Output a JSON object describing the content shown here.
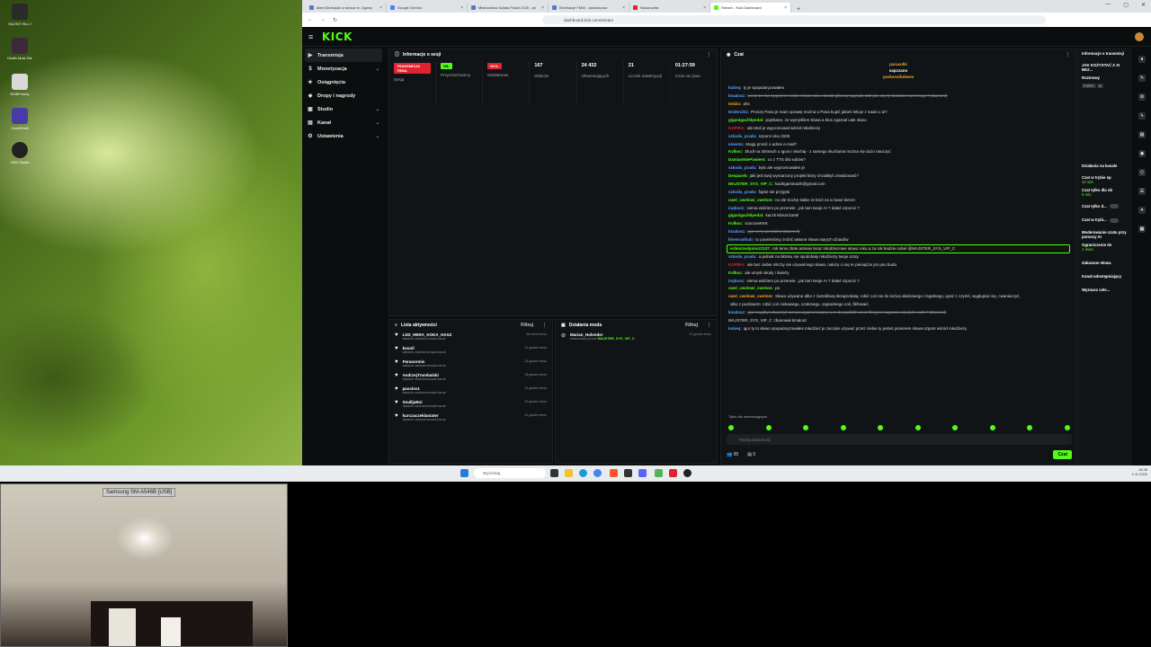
{
  "desktop": {
    "icons": [
      {
        "label": "SILENT HILL f",
        "color": "#2b2b2b"
      },
      {
        "label": "Death Must Die",
        "color": "#3a2a3a"
      },
      {
        "label": "ROBProkey",
        "color": "#d9d9d9"
      },
      {
        "label": "ChatWheel",
        "color": "#4a3aa8"
      },
      {
        "label": "OBS Studio",
        "color": "#222"
      }
    ]
  },
  "browser": {
    "tabs": [
      {
        "label": "Mam Bezludak w wiosce w ,Ogano"
      },
      {
        "label": "Google Gemini"
      },
      {
        "label": "Mistrzostwa Swiata Polski 2025 - pri"
      },
      {
        "label": "Eliminacje FMW - wiadomosci"
      },
      {
        "label": "Nowa karta"
      },
      {
        "label": "Stream - Kick Dashboard",
        "active": true
      }
    ],
    "url": "dashboard.kick.com/stream"
  },
  "kick": {
    "logo": "KICK",
    "nav": [
      {
        "label": "Transmisja",
        "icon": "▶",
        "active": true
      },
      {
        "label": "Monetyzacja",
        "icon": "$",
        "chev": "⌄"
      },
      {
        "label": "Osiągnięcia",
        "icon": "★"
      },
      {
        "label": "Dropy i nagrody",
        "icon": "◆"
      },
      {
        "label": "Studio",
        "icon": "▣",
        "chev": "⌄"
      },
      {
        "label": "Kanał",
        "icon": "▤",
        "chev": "⌄"
      },
      {
        "label": "Ustawienia",
        "icon": "⚙",
        "chev": "⌄"
      }
    ],
    "session": {
      "title": "Informacje o sesji",
      "stats": [
        {
          "badge": "TRANSMISJA TRWA",
          "color": "#e2222e",
          "label": "Sesja"
        },
        {
          "badge": "WŁ.",
          "color": "#53fc18",
          "label": "Przychód twórcy"
        },
        {
          "badge": "WYŁ.",
          "color": "#e2222e",
          "label": "Multistream"
        },
        {
          "value": "167",
          "label": "Widzów"
        },
        {
          "value": "24 432",
          "label": "Obserwujących"
        },
        {
          "value": "21",
          "label": "Licznik subskrypcji"
        },
        {
          "value": "01:27:59",
          "label": "Czas na żywo"
        }
      ]
    },
    "activity": {
      "title": "Lista aktywności",
      "filter": "Filtruj",
      "items": [
        {
          "name": "LSD_HERA_KOKA_HASZ",
          "sub": "właśnie zaobserwował kanał",
          "time": "26 minut temu"
        },
        {
          "name": "kosoil",
          "sub": "właśnie zaobserwował kanał",
          "time": "12 godzin temu"
        },
        {
          "name": "Paranormis",
          "sub": "właśnie zaobserwował kanał",
          "time": "18 godzin temu"
        },
        {
          "name": "AndrzejTrombalski",
          "sub": "właśnie zaobserwował kanał",
          "time": "18 godzin temu"
        },
        {
          "name": "pavclov1",
          "sub": "właśnie zaobserwował kanał",
          "time": "19 godzin temu"
        },
        {
          "name": "SoulljaBoi",
          "sub": "właśnie zaobserwował kanał",
          "time": "20 godzin temu"
        },
        {
          "name": "kurczaczeklaniater",
          "sub": "właśnie zaobserwował kanał",
          "time": "21 godzin temu"
        }
      ]
    },
    "mod": {
      "title": "Działania moda",
      "filter": "Filtruj",
      "items": [
        {
          "name": "Marian_Holender",
          "sub": "zbanowany przez",
          "by": "MAJSTER_SYS_VIP_C",
          "time": "21 godzin temu"
        }
      ]
    },
    "chat": {
      "title": "Czat",
      "pinned": [
        {
          "user": "parasolki",
          "color": "#f5a623"
        },
        {
          "user": "sapczano",
          "color": "#ddd"
        },
        {
          "user": "yankessthebees",
          "color": "#f5a623"
        }
      ],
      "messages": [
        {
          "user": "kubeq:",
          "color": "#5aa0ff",
          "text": "ty je spopularyzowałes"
        },
        {
          "user": "kmalosz:",
          "color": "#5aa0ff",
          "text": "wiesz ze kto wygrał ze ciebie słowa roku i dostał główną nagrodę 10k pln, czy ty dostałes cos z tego ? (Banned)",
          "strike": true
        },
        {
          "user": "tedzio:",
          "color": "#f5a623",
          "text": "ahs"
        },
        {
          "user": "Endercik1:",
          "color": "#5aa0ff",
          "text": "Proszę Pana je mam sprawę można u Pana kupić jakieś lekcje z nauki o ai?"
        },
        {
          "user": "giganigacfelpedal:",
          "color": "#53fc18",
          "text": "pojebane, ze wymyśliles słowa a ktos zgarnal cale slano"
        },
        {
          "user": "KOPIRA:",
          "color": "#e2222e",
          "text": "ale Moś je wypromował wśród młodziezy"
        },
        {
          "user": "szkoda_pradu:",
          "color": "#5aa0ff",
          "text": "szpont roku 2025"
        },
        {
          "user": "ementa:",
          "color": "#5aa0ff",
          "text": "Mogę prosić o adres e-mail?"
        },
        {
          "user": "Kvlkoc:",
          "color": "#53fc18",
          "text": "Słucił na strimach u Igora i słuchaj - z samego słuchania można się dużo nauczyć"
        },
        {
          "user": "DamianNiePowiem:",
          "color": "#53fc18",
          "text": "co z TTS dla subów?"
        },
        {
          "user": "szkoda_pradu:",
          "color": "#5aa0ff",
          "text": "było ale wypromowałes je"
        },
        {
          "user": "Desparek:",
          "color": "#53fc18",
          "text": "jaki jest twój wymarzony projekt który chciałbyś zrealizować?"
        },
        {
          "user": "MAJSTER_SYS_VIP_C:",
          "color": "#53fc18",
          "text": "kazikgaminazik@gmail.com"
        },
        {
          "user": "szkoda_pradu:",
          "color": "#5aa0ff",
          "text": "fajnie sie przyjęło"
        },
        {
          "user": "cwel_cwelowi_cwelom:",
          "color": "#53fc18",
          "text": "no ale trochę słabe ze ktoś za to kase bierze"
        },
        {
          "user": "inqbusz:",
          "color": "#5aa0ff",
          "text": "siema widziem po przerwie , jak tam twoje AI ? dałaś szponci ?"
        },
        {
          "user": "giganigacfelpedal:",
          "color": "#53fc18",
          "text": "kaczk klimat kartel"
        },
        {
          "user": "Kvlkoc:",
          "color": "#53fc18",
          "text": "szacuneKKK"
        },
        {
          "user": "kmalosz:",
          "color": "#5aa0ff",
          "text": "igor co ty pierdolisz (Banned)",
          "strike": true
        },
        {
          "user": "kheeruslhub:",
          "color": "#5aa0ff",
          "text": "to powinniśmy zrobić własne słowa starych dziadów"
        },
        {
          "user": "erdenizedymisz2137:",
          "color": "#53fc18",
          "text": "rok temu złote antosie teraz młodziezowe słowo roku a za rok bedzie nobel @MAJSTER_SYS_VIP_C",
          "highlight": true
        },
        {
          "user": "szkoda_pradu:",
          "color": "#5aa0ff",
          "text": "a jednak na tiktoku sie spodobały młodzieży twoje szoty"
        },
        {
          "user": "KOPIRA:",
          "color": "#e2222e",
          "text": "ale bez ciebie nikt by nie używał tego słowa, należy ci się te pieniążze jsn psu buda"
        },
        {
          "user": "Kvlkoc:",
          "color": "#53fc18",
          "text": "ale umysł młody i świeży"
        },
        {
          "user": "inqbusz:",
          "color": "#5aa0ff",
          "text": "siema widziem po przerwie , jak tam twoje AI ? dałaś szponci ?"
        },
        {
          "user": "cwel_cwelowi_cwelom:",
          "color": "#53fc18",
          "text": "pa"
        },
        {
          "user": "cwel_cwelowi_cwelom:",
          "color": "#f5a623",
          "text": "Słowo używane albo z żartobliwą dezaprobatą: robić coś nie do końca właściwego i legalnego, igrać z czymś, wygłupiać się, cwaniaczyć,"
        },
        {
          "user": "",
          "color": "#ddd",
          "text": "albo z podziwem: robić coś ciekawego, szalonego, orginalnego coś, fikfowaić."
        },
        {
          "user": "kmalosz:",
          "color": "#5aa0ff",
          "text": "igor mogłbys stworzyć serwis wygenerowany w AI do padlofil wiesz fikcyjne nagrania młodych osób ? (Banned)",
          "strike": true
        },
        {
          "user": "MAJSTER_SYS_VIP_C",
          "color": "#aaa",
          "text": "zbanował kmalosz"
        },
        {
          "user": "kubeq:",
          "color": "#5aa0ff",
          "text": "igor ty to słowo spopularyzowałes młodzież je zaczęło używać przez ciebie ty jesteś pionerem słowa szpont wśród młodzieży"
        }
      ],
      "followers_only": "Tylko dla obserwujących",
      "input_placeholder": "Wyślij wiadomość",
      "viewers": "00",
      "points": "0",
      "send": "Czat"
    },
    "stream_info": {
      "title": "Informacje o transmisji",
      "stream_title": "JAK KOŻYSTAĆ Z AI BEZ...",
      "category": "Rozmowy",
      "tags": [
        "Polish",
        "ai"
      ]
    },
    "channel_actions": {
      "title": "Działania na kanale",
      "items": [
        {
          "label": "Czat w trybie sp",
          "sub": "10 sek."
        },
        {
          "label": "Czat tylko dla ob",
          "sub": "6 min"
        },
        {
          "label": "Czat tylko d...",
          "toggle": true
        },
        {
          "label": "Czat w trybi...",
          "toggle": true
        },
        {
          "label": "Moderowanie czatu przy pomocy AI"
        },
        {
          "label": "Ograniczenie do",
          "sub": "1 mies."
        },
        {
          "label": "Zakazane słowa"
        },
        {
          "label": "Kanał udostępniający"
        },
        {
          "label": "Wyznacz cele..."
        }
      ]
    }
  },
  "taskbar": {
    "search_placeholder": "Wyszukaj",
    "time": "18:38",
    "date": "4.11.2025"
  },
  "camera": {
    "label": "Samsung SM-A546B [USB]"
  }
}
